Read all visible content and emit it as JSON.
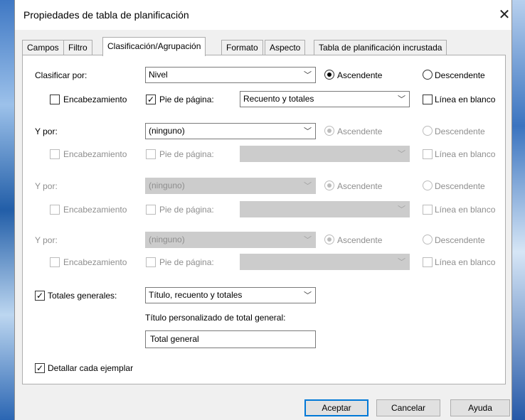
{
  "window": {
    "title": "Propiedades de tabla de planificación",
    "close_glyph": "✕"
  },
  "tabs": [
    {
      "label": "Campos"
    },
    {
      "label": "Filtro"
    },
    {
      "label": "Clasificación/Agrupación"
    },
    {
      "label": "Formato"
    },
    {
      "label": "Aspecto"
    },
    {
      "label": "Tabla de planificación incrustada"
    }
  ],
  "active_tab": "Clasificación/Agrupación",
  "sort_groups": [
    {
      "label": "Clasificar por:",
      "field_value": "Nivel",
      "ascending_label": "Ascendente",
      "descending_label": "Descendente",
      "order": "ascending",
      "header_label": "Encabezamiento",
      "header_checked": false,
      "footer_label": "Pie de página:",
      "footer_checked": true,
      "footer_value": "Recuento y totales",
      "blank_line_label": "Línea en blanco",
      "blank_line_checked": false,
      "enabled": true
    },
    {
      "label": "Y por:",
      "field_value": "(ninguno)",
      "ascending_label": "Ascendente",
      "descending_label": "Descendente",
      "order": "ascending",
      "header_label": "Encabezamiento",
      "header_checked": false,
      "footer_label": "Pie de página:",
      "footer_checked": false,
      "footer_value": "",
      "blank_line_label": "Línea en blanco",
      "blank_line_checked": false,
      "enabled": true
    },
    {
      "label": "Y por:",
      "field_value": "(ninguno)",
      "ascending_label": "Ascendente",
      "descending_label": "Descendente",
      "order": "ascending",
      "header_label": "Encabezamiento",
      "header_checked": false,
      "footer_label": "Pie de página:",
      "footer_checked": false,
      "footer_value": "",
      "blank_line_label": "Línea en blanco",
      "blank_line_checked": false,
      "enabled": false
    },
    {
      "label": "Y por:",
      "field_value": "(ninguno)",
      "ascending_label": "Ascendente",
      "descending_label": "Descendente",
      "order": "ascending",
      "header_label": "Encabezamiento",
      "header_checked": false,
      "footer_label": "Pie de página:",
      "footer_checked": false,
      "footer_value": "",
      "blank_line_label": "Línea en blanco",
      "blank_line_checked": false,
      "enabled": false
    }
  ],
  "grand_totals": {
    "label": "Totales generales:",
    "checked": true,
    "value": "Título, recuento y totales",
    "custom_title_label": "Título personalizado de total general:",
    "custom_title_value": "Total general"
  },
  "itemize": {
    "label": "Detallar cada ejemplar",
    "checked": true
  },
  "buttons": {
    "ok": "Aceptar",
    "cancel": "Cancelar",
    "help": "Ayuda"
  },
  "glyphs": {
    "check": "✓",
    "chevron": "﹀"
  }
}
